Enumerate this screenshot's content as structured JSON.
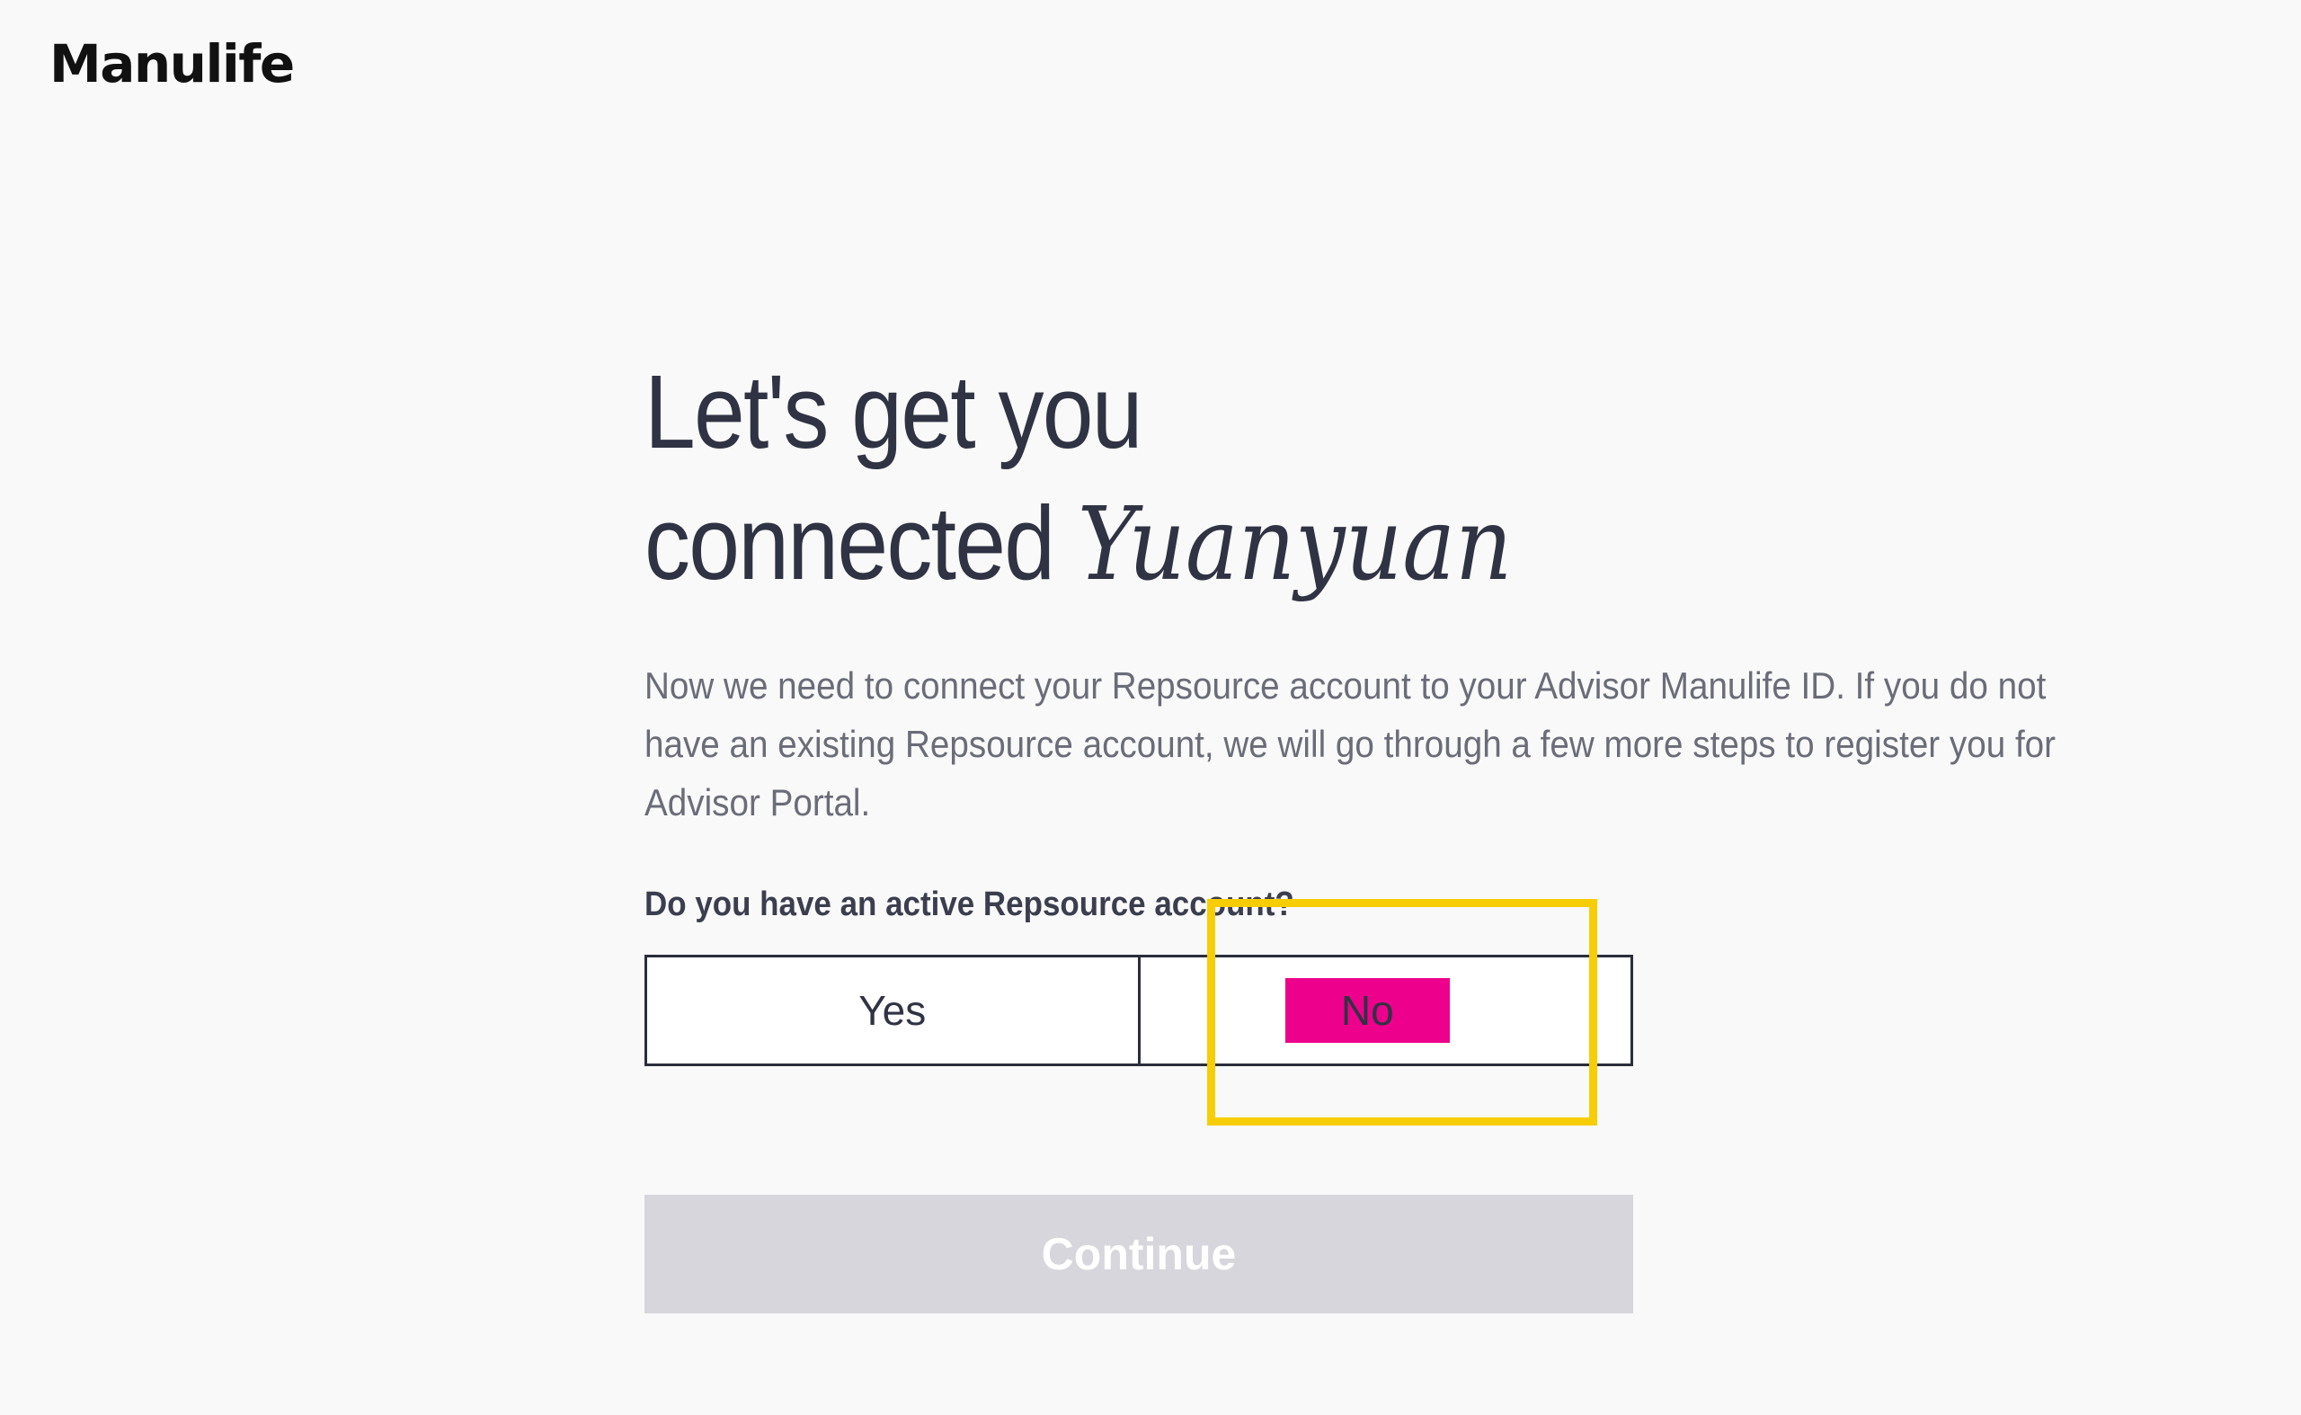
{
  "brand": {
    "logo_text": "Manulife"
  },
  "main": {
    "heading_line1": "Let's get you",
    "heading_line2_prefix": "connected ",
    "user_name": "Yuanyuan",
    "intro": "Now we need to connect your Repsource account to your Advisor Manulife ID. If you do not have an existing Repsource account, we will go through a few more steps to register you for Advisor Portal.",
    "question": "Do you have an active Repsource account?",
    "options": [
      {
        "label": "Yes",
        "selected": false
      },
      {
        "label": "No",
        "selected": true
      }
    ],
    "continue_label": "Continue",
    "continue_enabled": false
  },
  "colors": {
    "selected_option": "#ec008c",
    "highlight_box": "#f7cd05",
    "continue_disabled": "#d6d6dc"
  }
}
